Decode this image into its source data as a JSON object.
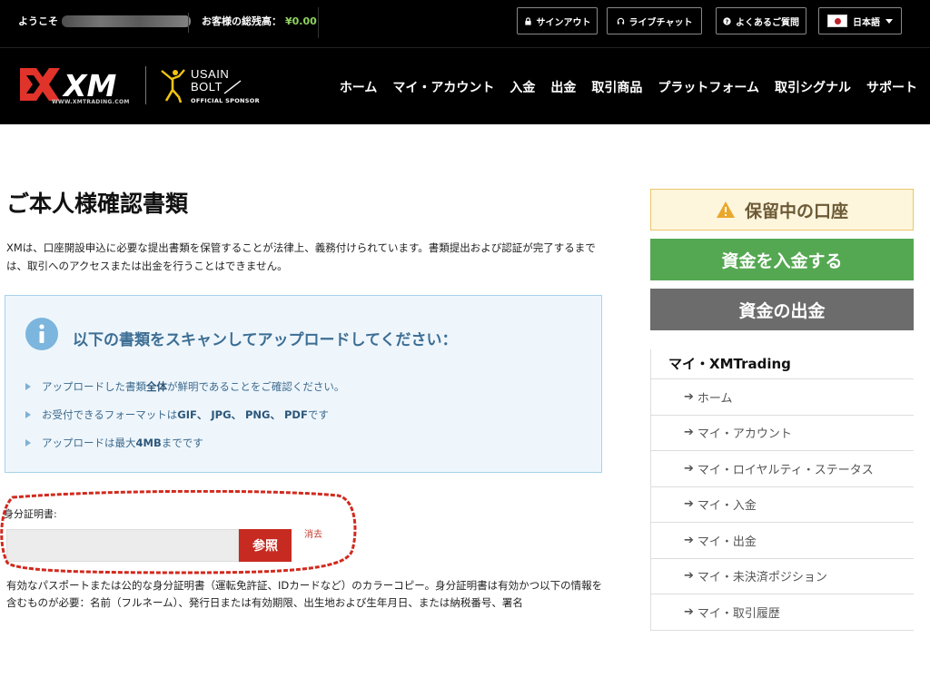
{
  "topbar": {
    "welcome": "ようこそ",
    "balance_label": "お客様の総残高：",
    "balance_value": "¥0.00",
    "signout": "サインアウト",
    "livechat": "ライブチャット",
    "faq": "よくあるご質問",
    "language": "日本語"
  },
  "header": {
    "logo_text": "XM",
    "logo_tag": "WWW.XMTRADING.COM",
    "sponsor_line1": "USAIN",
    "sponsor_line2": "BOLT",
    "sponsor_line3": "OFFICIAL SPONSOR",
    "nav": [
      "ホーム",
      "マイ・アカウント",
      "入金",
      "出金",
      "取引商品",
      "プラットフォーム",
      "取引シグナル",
      "サポート"
    ]
  },
  "main": {
    "title": "ご本人様確認書類",
    "intro": "XMは、口座開設申込に必要な提出書類を保管することが法律上、義務付けられています。書類提出および認証が完了するまでは、取引へのアクセスまたは出金を行うことはできません。",
    "info_title": "以下の書類をスキャンしてアップロードしてください：",
    "bullet1_pre": "アップロードした書類",
    "bullet1_bold": "全体",
    "bullet1_post": "が鮮明であることをご確認ください。",
    "bullet2_pre": "お受付できるフォーマットは ",
    "bullet2_bold": "GIF、 JPG、 PNG、 PDF",
    "bullet2_post": "です",
    "bullet3_pre": "アップロードは最大 ",
    "bullet3_bold": "4MB",
    "bullet3_post": "までです",
    "id_label": "身分証明書:",
    "browse": "参照",
    "clear": "消去",
    "description": "有効なパスポートまたは公的な身分証明書（運転免許証、IDカードなど）のカラーコピー。身分証明書は有効かつ以下の情報を含むものが必要：名前（フルネーム）、発行日または有効期限、出生地および生年月日、または納税番号、署名"
  },
  "sidebar": {
    "pending": "保留中の口座",
    "deposit": "資金を入金する",
    "withdraw": "資金の出金",
    "menu_title": "マイ・XMTrading",
    "items": [
      "ホーム",
      "マイ・アカウント",
      "マイ・ロイヤルティ・ステータス",
      "マイ・入金",
      "マイ・出金",
      "マイ・未決済ポジション",
      "マイ・取引履歴"
    ]
  },
  "colors": {
    "accent_red": "#c62a20",
    "deposit_green": "#55a852",
    "withdraw_gray": "#6c6c6c",
    "info_blue": "#3d6e94"
  }
}
